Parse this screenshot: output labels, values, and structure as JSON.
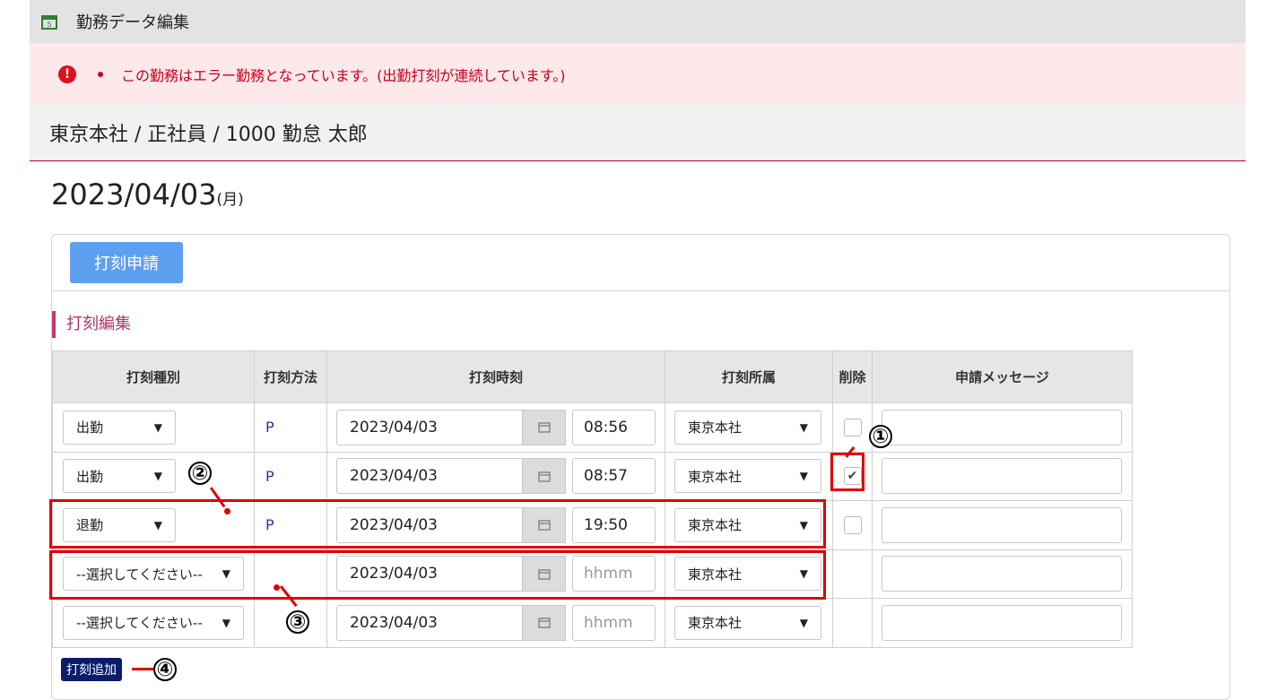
{
  "header": {
    "title": "勤務データ編集"
  },
  "error": {
    "message": "この勤務はエラー勤務となっています。(出勤打刻が連続しています。)"
  },
  "employee": {
    "label": "東京本社 / 正社員 / 1000 勤怠 太郎"
  },
  "date": {
    "value": "2023/04/03",
    "weekday": "(月)"
  },
  "actions": {
    "apply_label": "打刻申請",
    "add_label": "打刻追加"
  },
  "section": {
    "title": "打刻編集"
  },
  "table": {
    "headers": [
      "打刻種別",
      "打刻方法",
      "打刻時刻",
      "打刻所属",
      "削除",
      "申請メッセージ"
    ],
    "rows": [
      {
        "type": "出勤",
        "method": "P",
        "date": "2023/04/03",
        "time": "08:56",
        "org": "東京本社",
        "delete": "unchecked"
      },
      {
        "type": "出勤",
        "method": "P",
        "date": "2023/04/03",
        "time": "08:57",
        "org": "東京本社",
        "delete": "checked"
      },
      {
        "type": "退勤",
        "method": "P",
        "date": "2023/04/03",
        "time": "19:50",
        "org": "東京本社",
        "delete": "unchecked"
      },
      {
        "type": "--選択してください--",
        "method": "",
        "date": "2023/04/03",
        "time_placeholder": "hhmm",
        "org": "東京本社",
        "delete": "none"
      },
      {
        "type": "--選択してください--",
        "method": "",
        "date": "2023/04/03",
        "time_placeholder": "hhmm",
        "org": "東京本社",
        "delete": "none"
      }
    ]
  },
  "callouts": [
    "①",
    "②",
    "③",
    "④"
  ],
  "colors": {
    "error_red": "#e0101e",
    "highlight_red": "#e00000",
    "apply_blue": "#5ea0f0",
    "add_navy": "#0b1c6b"
  }
}
